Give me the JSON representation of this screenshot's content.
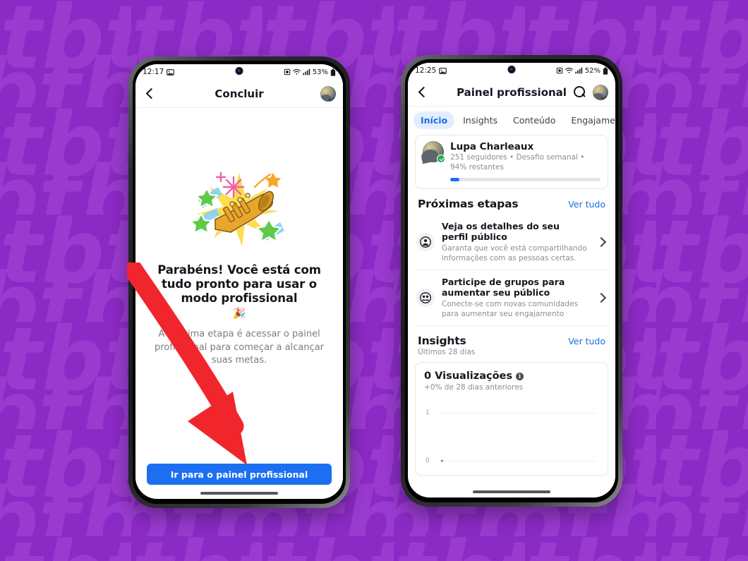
{
  "background": {
    "color": "#8B2BC6",
    "watermark_text": "tb",
    "watermark_color": "#9739CE"
  },
  "phone_left": {
    "status_bar": {
      "time": "12:17",
      "gallery_icon": "image-icon",
      "alarm_icon": "alarm-icon",
      "wifi_icon": "wifi-icon",
      "signal_icon": "signal-bars-icon",
      "battery_percent": "53%",
      "battery_icon": "battery-icon"
    },
    "app_bar": {
      "back_icon": "back-chevron-icon",
      "title": "Concluir",
      "avatar_icon": "profile-avatar-icon"
    },
    "illustration": "trumpet-celebration-icon",
    "headline": "Parabéns! Você está com tudo pronto para usar o modo profissional",
    "party_emoji": "🎉",
    "subtext": "A próxima etapa é acessar o painel profissional para começar a alcançar suas metas.",
    "cta_label": "Ir para o painel profissional",
    "cta_color": "#1D6FF2",
    "annotation_arrow": {
      "icon": "red-curved-arrow-icon",
      "color": "#F0262C"
    }
  },
  "phone_right": {
    "status_bar": {
      "time": "12:25",
      "gallery_icon": "image-icon",
      "alarm_icon": "alarm-icon",
      "wifi_icon": "wifi-icon",
      "signal_icon": "signal-bars-icon",
      "battery_percent": "52%",
      "battery_icon": "battery-icon"
    },
    "app_bar": {
      "back_icon": "back-chevron-icon",
      "title": "Painel profissional",
      "search_icon": "search-icon",
      "avatar_icon": "profile-avatar-icon"
    },
    "tabs": [
      {
        "label": "Início",
        "active": true
      },
      {
        "label": "Insights",
        "active": false
      },
      {
        "label": "Conteúdo",
        "active": false
      },
      {
        "label": "Engajamento",
        "active": false
      }
    ],
    "profile_card": {
      "avatar_icon": "profile-avatar-icon",
      "verified_icon": "verified-check-icon",
      "name": "Lupa Charleaux",
      "meta": "251 seguidores • Desafio semanal • 94% restantes",
      "progress_percent": 6,
      "progress_color": "#1D6FF2"
    },
    "next_steps": {
      "title": "Próximas etapas",
      "see_all": "Ver tudo",
      "items": [
        {
          "icon": "person-circle-icon",
          "title": "Veja os detalhes do seu perfil público",
          "description": "Garanta que você está compartilhando informações com as pessoas certas.",
          "chevron_icon": "chevron-right-icon"
        },
        {
          "icon": "group-people-icon",
          "title": "Participe de grupos para aumentar seu público",
          "description": "Conecte-se com novas comunidades para aumentar seu engajamento",
          "chevron_icon": "chevron-right-icon"
        }
      ]
    },
    "insights": {
      "title": "Insights",
      "see_all": "Ver tudo",
      "subtitle": "Últimos 28 dias",
      "metric_card": {
        "value_label": "0 Visualizações",
        "info_icon": "info-icon",
        "delta": "+0% de 28 dias anteriores"
      }
    }
  },
  "chart_data": {
    "type": "line",
    "title": "0 Visualizações",
    "subtitle": "+0% de 28 dias anteriores",
    "xlabel": "",
    "ylabel": "",
    "x": [
      0
    ],
    "values": [
      0
    ],
    "ytick_labels": [
      "1",
      "0"
    ],
    "ylim": [
      0,
      1
    ],
    "grid": true,
    "legend": "none",
    "series": [
      {
        "name": "Visualizações",
        "values": [
          0
        ],
        "color": "#4F8CF0"
      }
    ]
  }
}
